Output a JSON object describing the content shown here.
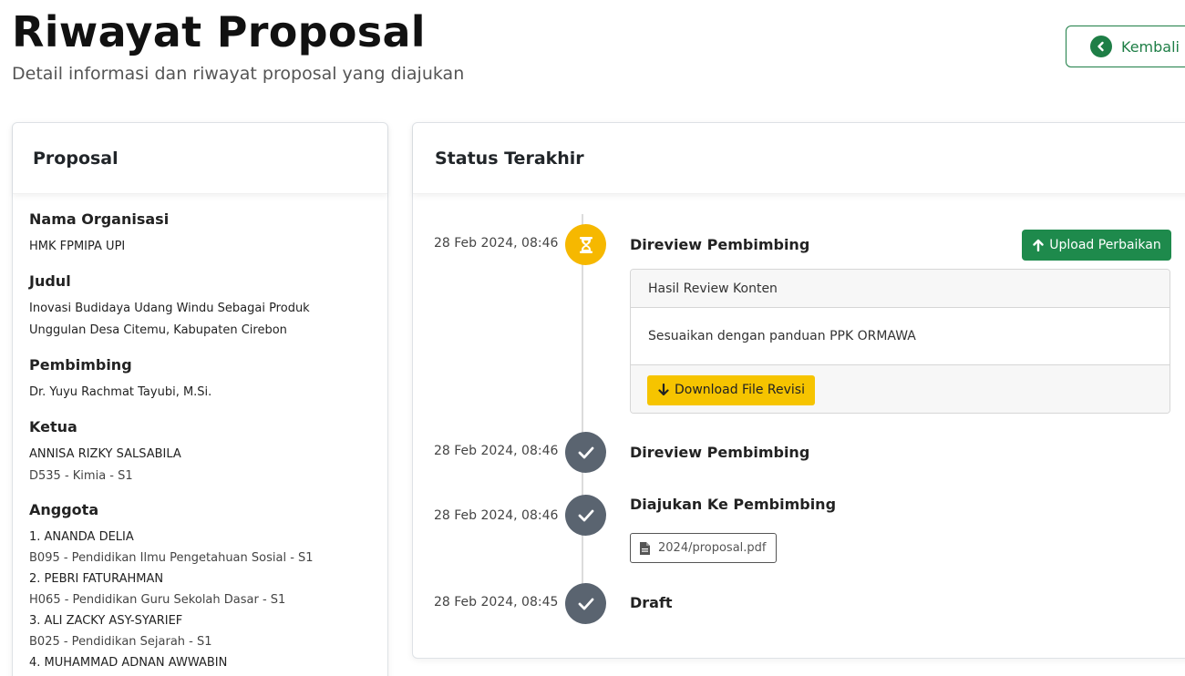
{
  "header": {
    "title": "Riwayat Proposal",
    "subtitle": "Detail informasi dan riwayat proposal yang diajukan",
    "back_label": "Kembali"
  },
  "proposal": {
    "card_title": "Proposal",
    "org_label": "Nama Organisasi",
    "org_value": "HMK FPMIPA UPI",
    "title_label": "Judul",
    "title_line1": "Inovasi Budidaya Udang Windu Sebagai Produk",
    "title_line2": "Unggulan Desa Citemu, Kabupaten Cirebon",
    "advisor_label": "Pembimbing",
    "advisor_value": "Dr. Yuyu Rachmat Tayubi, M.Si.",
    "leader_label": "Ketua",
    "leader_name": "ANNISA RIZKY SALSABILA",
    "leader_meta": "D535 - Kimia - S1",
    "members_label": "Anggota",
    "members": [
      {
        "name": "1. ANANDA DELIA",
        "meta": "B095 - Pendidikan Ilmu Pengetahuan Sosial - S1"
      },
      {
        "name": "2. PEBRI FATURAHMAN",
        "meta": "H065 - Pendidikan Guru Sekolah Dasar - S1"
      },
      {
        "name": "3. ALI ZACKY ASY-SYARIEF",
        "meta": "B025 - Pendidikan Sejarah - S1"
      },
      {
        "name": "4. MUHAMMAD ADNAN AWWABIN",
        "meta": ""
      }
    ]
  },
  "status": {
    "card_title": "Status Terakhir",
    "items": [
      {
        "date": "28 Feb 2024, 08:46",
        "title": "Direview Pembimbing",
        "state": "pending",
        "action_label": "Upload Perbaikan",
        "review_header": "Hasil Review Konten",
        "review_body": "Sesuaikan dengan panduan PPK ORMAWA",
        "download_label": "Download File Revisi"
      },
      {
        "date": "28 Feb 2024, 08:46",
        "title": "Direview Pembimbing",
        "state": "done"
      },
      {
        "date": "28 Feb 2024, 08:46",
        "title": "Diajukan Ke Pembimbing",
        "state": "done",
        "file_label": "2024/proposal.pdf"
      },
      {
        "date": "28 Feb 2024, 08:45",
        "title": "Draft",
        "state": "done"
      }
    ]
  },
  "colors": {
    "primary_green": "#1e8a4c",
    "pending_yellow": "#f6b800",
    "done_gray": "#5a6470"
  }
}
